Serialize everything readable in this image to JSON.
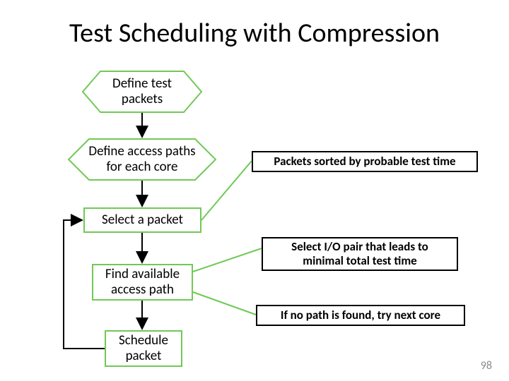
{
  "title": "Test Scheduling with Compression",
  "nodes": {
    "define_packets": "Define test\npackets",
    "define_paths": "Define access paths\nfor each core",
    "select_packet": "Select a packet",
    "find_path": "Find available\naccess path",
    "schedule_packet": "Schedule\npacket"
  },
  "annotations": {
    "sorted": "Packets sorted by probable test time",
    "io_pair": "Select I/O pair that leads to\nminimal total test time",
    "no_path": "If no path is found, try next core"
  },
  "page_number": "98"
}
